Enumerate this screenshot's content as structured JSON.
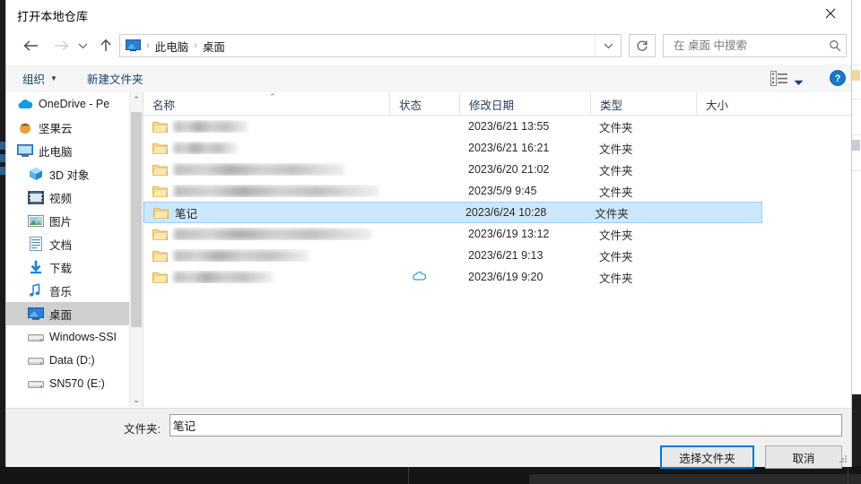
{
  "window": {
    "title": "打开本地仓库",
    "close_label": "✕"
  },
  "nav": {
    "back": "←",
    "forward": "→",
    "recent": "⌄",
    "up": "↑",
    "refresh": "↻",
    "address_dropdown": "⌄"
  },
  "address": {
    "icon": "desktop-icon",
    "separator": "›",
    "crumbs": [
      "此电脑",
      "桌面"
    ]
  },
  "search": {
    "placeholder": "在 桌面 中搜索",
    "value": "",
    "icon": "search-icon"
  },
  "commandbar": {
    "organize": "组织",
    "organize_caret": "▼",
    "new_folder": "新建文件夹",
    "view_icon": "details-view-icon",
    "view_caret": "▼",
    "help": "?"
  },
  "sidebar": {
    "items": [
      {
        "label": "OneDrive - Pe",
        "icon": "onedrive-cloud-icon",
        "level": 0,
        "selected": false
      },
      {
        "label": "坚果云",
        "icon": "nutstore-icon",
        "level": 0,
        "selected": false
      },
      {
        "label": "此电脑",
        "icon": "this-pc-icon",
        "level": 0,
        "selected": false
      },
      {
        "label": "3D 对象",
        "icon": "3d-objects-icon",
        "level": 1,
        "selected": false
      },
      {
        "label": "视频",
        "icon": "videos-icon",
        "level": 1,
        "selected": false
      },
      {
        "label": "图片",
        "icon": "pictures-icon",
        "level": 1,
        "selected": false
      },
      {
        "label": "文档",
        "icon": "documents-icon",
        "level": 1,
        "selected": false
      },
      {
        "label": "下载",
        "icon": "downloads-icon",
        "level": 1,
        "selected": false
      },
      {
        "label": "音乐",
        "icon": "music-icon",
        "level": 1,
        "selected": false
      },
      {
        "label": "桌面",
        "icon": "desktop-icon",
        "level": 1,
        "selected": true
      },
      {
        "label": "Windows-SSI",
        "icon": "drive-icon",
        "level": 1,
        "selected": false
      },
      {
        "label": "Data (D:)",
        "icon": "drive-icon",
        "level": 1,
        "selected": false
      },
      {
        "label": "SN570 (E:)",
        "icon": "drive-icon",
        "level": 1,
        "selected": false
      }
    ],
    "scroll_up": "⌃",
    "scroll_down": "⌄"
  },
  "filelist": {
    "columns": [
      "名称",
      "状态",
      "修改日期",
      "类型",
      "大小"
    ],
    "sort_indicator": "⌃",
    "rows": [
      {
        "name": "",
        "redacted": true,
        "status": "",
        "date": "2023/6/21 13:55",
        "type": "文件夹",
        "size": "",
        "selected": false
      },
      {
        "name": "",
        "redacted": true,
        "status": "",
        "date": "2023/6/21 16:21",
        "type": "文件夹",
        "size": "",
        "selected": false
      },
      {
        "name": "",
        "redacted": true,
        "status": "",
        "date": "2023/6/20 21:02",
        "type": "文件夹",
        "size": "",
        "selected": false
      },
      {
        "name": "",
        "redacted": true,
        "status": "",
        "date": "2023/5/9 9:45",
        "type": "文件夹",
        "size": "",
        "selected": false
      },
      {
        "name": "笔记",
        "redacted": false,
        "status": "",
        "date": "2023/6/24 10:28",
        "type": "文件夹",
        "size": "",
        "selected": true
      },
      {
        "name": "",
        "redacted": true,
        "status": "",
        "date": "2023/6/19 13:12",
        "type": "文件夹",
        "size": "",
        "selected": false
      },
      {
        "name": "",
        "redacted": true,
        "status": "",
        "date": "2023/6/21 9:13",
        "type": "文件夹",
        "size": "",
        "selected": false
      },
      {
        "name": "",
        "redacted": true,
        "status": "cloud-icon",
        "date": "2023/6/19 9:20",
        "type": "文件夹",
        "size": "",
        "selected": false
      }
    ]
  },
  "footer": {
    "folder_label": "文件夹:",
    "folder_value": "笔记",
    "select_button": "选择文件夹",
    "cancel_button": "取消"
  },
  "colors": {
    "accent": "#0078d7",
    "selection_fill": "#cce8ff",
    "selection_border": "#99d1ff",
    "folder_yellow": "#ffd98a",
    "command_text": "#1c3f6e"
  }
}
